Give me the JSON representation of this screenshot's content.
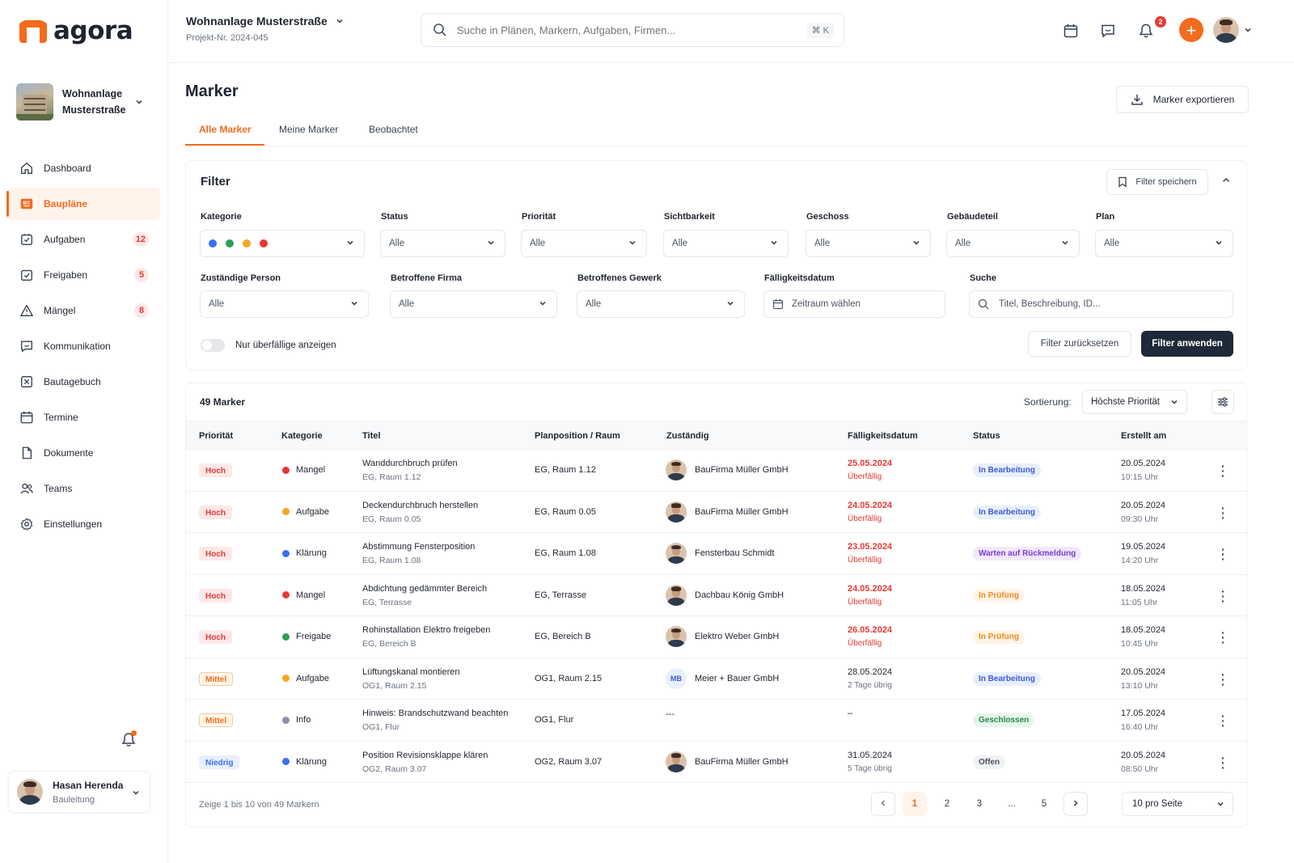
{
  "brand": {
    "name": "agora",
    "accent": "#f36b1c"
  },
  "sidebar": {
    "project": {
      "name": "Wohnanlage Musterstraße"
    },
    "items": [
      {
        "label": "Dashboard",
        "icon": "home-icon",
        "badge": ""
      },
      {
        "label": "Baupläne",
        "icon": "blueprint-icon",
        "badge": "",
        "active": true
      },
      {
        "label": "Aufgaben",
        "icon": "task-check-icon",
        "badge": "12"
      },
      {
        "label": "Freigaben",
        "icon": "approval-icon",
        "badge": "5"
      },
      {
        "label": "Mängel",
        "icon": "warning-icon",
        "badge": "8"
      },
      {
        "label": "Kommunikation",
        "icon": "chat-icon",
        "badge": ""
      },
      {
        "label": "Bautagebuch",
        "icon": "diary-icon",
        "badge": ""
      },
      {
        "label": "Termine",
        "icon": "calendar-icon",
        "badge": ""
      },
      {
        "label": "Dokumente",
        "icon": "document-icon",
        "badge": ""
      },
      {
        "label": "Teams",
        "icon": "team-icon",
        "badge": ""
      },
      {
        "label": "Einstellungen",
        "icon": "gear-icon",
        "badge": ""
      }
    ],
    "user": {
      "name": "Hasan Herenda",
      "role": "Bauleitung"
    }
  },
  "header": {
    "project_title": "Wohnanlage Musterstraße",
    "project_number": "Projekt-Nr. 2024-045",
    "search_placeholder": "Suche in Plänen, Markern, Aufgaben, Firmen...",
    "search_shortcut": "⌘ K",
    "notification_count": "2"
  },
  "page": {
    "title": "Marker",
    "export_label": "Marker exportieren",
    "tabs": [
      "Alle Marker",
      "Meine Marker",
      "Beobachtet"
    ]
  },
  "filter": {
    "title": "Filter",
    "save_label": "Filter speichern",
    "labels": {
      "kategorie": "Kategorie",
      "status": "Status",
      "prioritaet": "Priorität",
      "sichtbarkeit": "Sichtbarkeit",
      "geschoss": "Geschoss",
      "gebaeudeteil": "Gebäudeteil",
      "plan": "Plan",
      "person": "Zuständige Person",
      "firma": "Betroffene Firma",
      "gewerk": "Betroffenes Gewerk",
      "faellig": "Fälligkeitsdatum",
      "suche": "Suche"
    },
    "all_value": "Alle",
    "date_placeholder": "Zeitraum wählen",
    "search_placeholder": "Titel, Beschreibung, ID...",
    "category_colors": [
      "#3b6ff5",
      "#2e9e5b",
      "#f5a623",
      "#e53935"
    ],
    "overdue_toggle_label": "Nur überfällige anzeigen",
    "reset_label": "Filter zurücksetzen",
    "apply_label": "Filter anwenden"
  },
  "table": {
    "count_label": "49 Marker",
    "sort_label": "Sortierung:",
    "sort_value": "Höchste Priorität",
    "columns": [
      "Priorität",
      "Kategorie",
      "Titel",
      "Planposition / Raum",
      "Zuständig",
      "Fälligkeitsdatum",
      "Status",
      "Erstellt am"
    ],
    "rows": [
      {
        "priority": "Hoch",
        "category": "Mangel",
        "category_color": "#e53935",
        "title": "Wanddurchbruch prüfen",
        "subtitle": "EG, Raum 1.12",
        "position": "EG, Raum 1.12",
        "assignee": "BauFirma Müller GmbH",
        "assignee_avatar": "photo",
        "due": "25.05.2024",
        "due_note": "Überfällig",
        "overdue": true,
        "status": "In Bearbeitung",
        "status_kind": "blue",
        "created_date": "20.05.2024",
        "created_time": "10:15 Uhr"
      },
      {
        "priority": "Hoch",
        "category": "Aufgabe",
        "category_color": "#f5a623",
        "title": "Deckendurchbruch herstellen",
        "subtitle": "EG, Raum 0.05",
        "position": "EG, Raum 0.05",
        "assignee": "BauFirma Müller GmbH",
        "assignee_avatar": "photo",
        "due": "24.05.2024",
        "due_note": "Überfällig",
        "overdue": true,
        "status": "In Bearbeitung",
        "status_kind": "blue",
        "created_date": "20.05.2024",
        "created_time": "09:30 Uhr"
      },
      {
        "priority": "Hoch",
        "category": "Klärung",
        "category_color": "#3b6ff5",
        "title": "Abstimmung Fensterposition",
        "subtitle": "EG, Raum 1.08",
        "position": "EG, Raum 1.08",
        "assignee": "Fensterbau Schmidt",
        "assignee_avatar": "photo",
        "due": "23.05.2024",
        "due_note": "Überfällig",
        "overdue": true,
        "status": "Warten auf Rückmeldung",
        "status_kind": "purple",
        "created_date": "19.05.2024",
        "created_time": "14:20 Uhr"
      },
      {
        "priority": "Hoch",
        "category": "Mangel",
        "category_color": "#e53935",
        "title": "Abdichtung gedämmter Bereich",
        "subtitle": "EG, Terrasse",
        "position": "EG, Terrasse",
        "assignee": "Dachbau König GmbH",
        "assignee_avatar": "photo",
        "due": "24.05.2024",
        "due_note": "Überfällig",
        "overdue": true,
        "status": "In Prüfung",
        "status_kind": "orange",
        "created_date": "18.05.2024",
        "created_time": "11:05 Uhr"
      },
      {
        "priority": "Hoch",
        "category": "Freigabe",
        "category_color": "#2e9e5b",
        "title": "Rohinstallation Elektro freigeben",
        "subtitle": "EG, Bereich B",
        "position": "EG, Bereich B",
        "assignee": "Elektro Weber GmbH",
        "assignee_avatar": "photo",
        "due": "26.05.2024",
        "due_note": "Überfällig",
        "overdue": true,
        "status": "In Prüfung",
        "status_kind": "orange",
        "created_date": "18.05.2024",
        "created_time": "10:45 Uhr"
      },
      {
        "priority": "Mittel",
        "category": "Aufgabe",
        "category_color": "#f5a623",
        "title": "Lüftungskanal montieren",
        "subtitle": "OG1, Raum 2.15",
        "position": "OG1, Raum 2.15",
        "assignee": "Meier + Bauer GmbH",
        "assignee_avatar": "MB",
        "due": "28.05.2024",
        "due_note": "2 Tage übrig",
        "overdue": false,
        "status": "In Bearbeitung",
        "status_kind": "blue",
        "created_date": "20.05.2024",
        "created_time": "13:10 Uhr"
      },
      {
        "priority": "Mittel",
        "category": "Info",
        "category_color": "#8b93a1",
        "title": "Hinweis: Brandschutzwand beachten",
        "subtitle": "OG1, Flur",
        "position": "OG1, Flur",
        "assignee": "---",
        "assignee_avatar": "",
        "due": "–",
        "due_note": "",
        "overdue": false,
        "status": "Geschlossen",
        "status_kind": "green",
        "created_date": "17.05.2024",
        "created_time": "16:40 Uhr"
      },
      {
        "priority": "Niedrig",
        "category": "Klärung",
        "category_color": "#3b6ff5",
        "title": "Position Revisionsklappe klären",
        "subtitle": "OG2, Raum 3.07",
        "position": "OG2, Raum 3.07",
        "assignee": "BauFirma Müller GmbH",
        "assignee_avatar": "photo",
        "due": "31.05.2024",
        "due_note": "5 Tage übrig",
        "overdue": false,
        "status": "Offen",
        "status_kind": "gray",
        "created_date": "20.05.2024",
        "created_time": "08:50 Uhr"
      }
    ],
    "footer_text": "Zeige 1 bis 10 von 49 Markern",
    "pages": [
      "1",
      "2",
      "3",
      "...",
      "5"
    ],
    "per_page": "10 pro Seite"
  }
}
